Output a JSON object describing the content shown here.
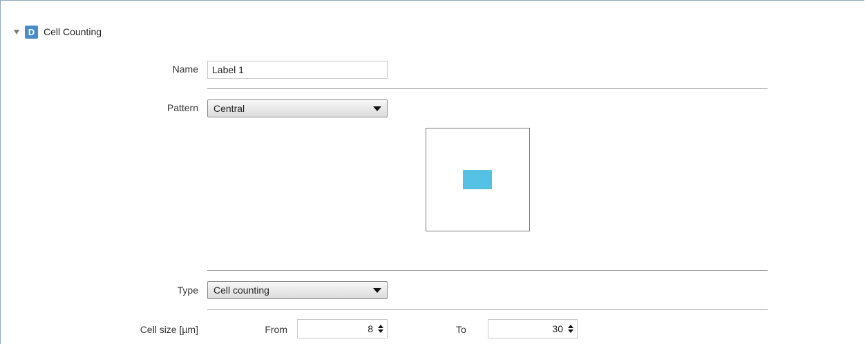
{
  "section": {
    "badge": "D",
    "title": "Cell Counting"
  },
  "fields": {
    "name_label": "Name",
    "name_value": "Label 1",
    "pattern_label": "Pattern",
    "pattern_value": "Central",
    "type_label": "Type",
    "type_value": "Cell counting",
    "cell_size_label": "Cell size [µm]",
    "from_label": "From",
    "from_value": "8",
    "to_label": "To",
    "to_value": "30"
  },
  "colors": {
    "badge": "#4a8ac6",
    "pattern_fill": "#55c1e4"
  },
  "icons": {
    "collapse": "triangle-down",
    "dropdown": "caret-down",
    "spinner": "up-down-arrows"
  }
}
